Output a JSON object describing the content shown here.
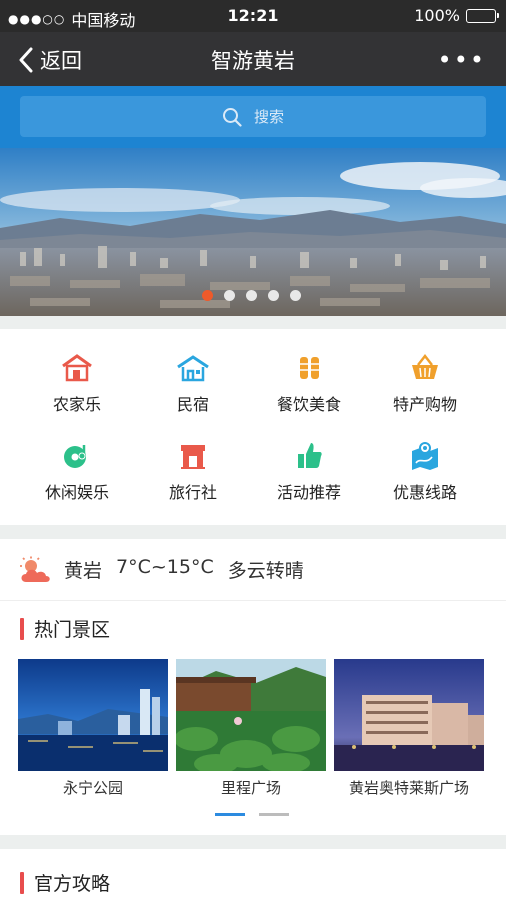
{
  "status": {
    "carrier": "中国移动",
    "signal_dots": "●●●○○",
    "time": "12:21",
    "battery": "100%"
  },
  "nav": {
    "back_label": "返回",
    "title": "智游黄岩",
    "more": "•••"
  },
  "search": {
    "placeholder": "搜索"
  },
  "banner": {
    "slides": 5,
    "active_index": 0
  },
  "categories": [
    {
      "label": "农家乐",
      "icon": "farmhouse-icon",
      "color": "#e9594a"
    },
    {
      "label": "民宿",
      "icon": "homestay-icon",
      "color": "#2aa6df"
    },
    {
      "label": "餐饮美食",
      "icon": "food-icon",
      "color": "#f0a02c"
    },
    {
      "label": "特产购物",
      "icon": "shopping-basket-icon",
      "color": "#f0a02c"
    },
    {
      "label": "休闲娱乐",
      "icon": "music-disc-icon",
      "color": "#2cc08a"
    },
    {
      "label": "旅行社",
      "icon": "travel-agency-icon",
      "color": "#e9594a"
    },
    {
      "label": "活动推荐",
      "icon": "thumbs-up-icon",
      "color": "#2cc08a"
    },
    {
      "label": "优惠线路",
      "icon": "route-map-icon",
      "color": "#2aa6df"
    }
  ],
  "weather": {
    "icon": "cloud-sun-icon",
    "city": "黄岩",
    "temp": "7°C~15°C",
    "desc": "多云转晴"
  },
  "hot_spots": {
    "title": "热门景区",
    "items": [
      {
        "name": "永宁公园"
      },
      {
        "name": "里程广场"
      },
      {
        "name": "黄岩奥特莱斯广场"
      }
    ],
    "pages": 2,
    "active_page": 0
  },
  "guide": {
    "title": "官方攻略"
  },
  "colors": {
    "nav": "#333335",
    "search_bg": "#1d84d2",
    "accent_red": "#e84d4d",
    "accent_blue": "#2c8be0"
  }
}
